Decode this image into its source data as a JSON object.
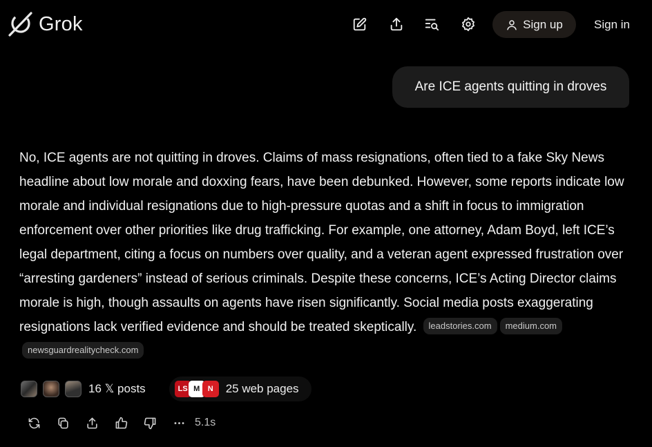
{
  "brand": {
    "name": "Grok",
    "logo_icon": "grok-logo"
  },
  "toolbar": {
    "icons": [
      "edit-icon",
      "share-upload-icon",
      "search-history-icon",
      "settings-gear-icon"
    ],
    "signup_label": "Sign up",
    "signin_label": "Sign in"
  },
  "user_message": "Are ICE agents quitting in droves",
  "answer": {
    "text": "No, ICE agents are not quitting in droves. Claims of mass resignations, often tied to a fake Sky News headline about low morale and doxxing fears, have been debunked. However, some reports indicate low morale and individual resignations due to high-pressure quotas and a shift in focus to immigration enforcement over other priorities like drug trafficking. For example, one attorney, Adam Boyd, left ICE’s legal department, citing a focus on numbers over quality, and a veteran agent expressed frustration over “arresting gardeners” instead of serious criminals. Despite these concerns, ICE’s Acting Director claims morale is high, though assaults on agents have risen significantly. Social media posts exaggerating resignations lack verified evidence and should be treated skeptically.",
    "citations": [
      "leadstories.com",
      "medium.com",
      "newsguardrealitycheck.com"
    ]
  },
  "sources": {
    "x_posts_label": "16 𝕏 posts",
    "web_pages_label": "25 web pages"
  },
  "actions": {
    "icons": [
      "regenerate-icon",
      "copy-icon",
      "share-icon",
      "thumbs-up-icon",
      "thumbs-down-icon",
      "more-icon"
    ],
    "timing": "5.1s"
  },
  "colors": {
    "background": "#000000",
    "bubble": "#1c1c1c",
    "chip": "#1e1e1e",
    "signup_bg": "#1f1b18"
  }
}
